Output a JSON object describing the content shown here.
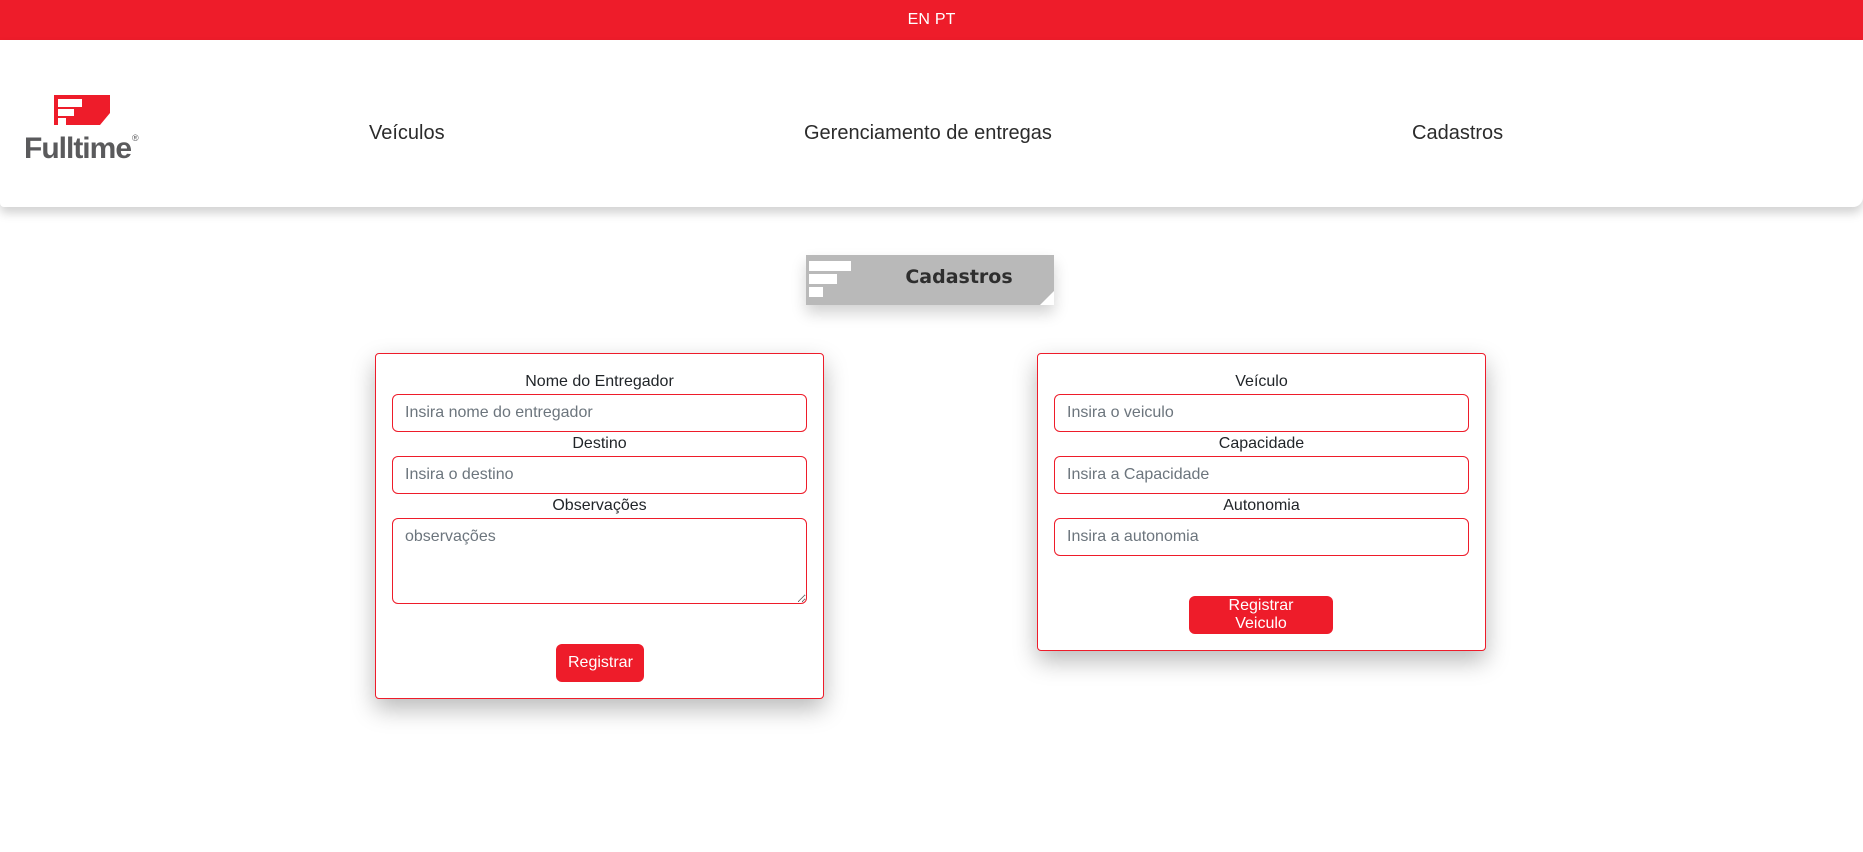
{
  "topbar": {
    "lang_en": "EN",
    "lang_pt": "PT",
    "background": "#ee1c2a"
  },
  "header": {
    "logo_text": "Fulltime",
    "logo_reg": "®",
    "nav": [
      {
        "label": "Veículos"
      },
      {
        "label": "Gerenciamento de entregas"
      },
      {
        "label": "Cadastros"
      }
    ]
  },
  "section": {
    "title": "Cadastros"
  },
  "delivery_form": {
    "name_label": "Nome do Entregador",
    "name_placeholder": "Insira nome do entregador",
    "destination_label": "Destino",
    "destination_placeholder": "Insira o destino",
    "notes_label": "Observações",
    "notes_placeholder": "observações",
    "submit_label": "Registrar"
  },
  "vehicle_form": {
    "vehicle_label": "Veículo",
    "vehicle_placeholder": "Insira o veiculo",
    "capacity_label": "Capacidade",
    "capacity_placeholder": "Insira a Capacidade",
    "autonomy_label": "Autonomia",
    "autonomy_placeholder": "Insira a autonomia",
    "submit_label": "Registrar Veiculo"
  },
  "colors": {
    "accent": "#ee1c2a",
    "badge_gray": "#b9b9b9",
    "logo_gray": "#5a5a5c"
  }
}
